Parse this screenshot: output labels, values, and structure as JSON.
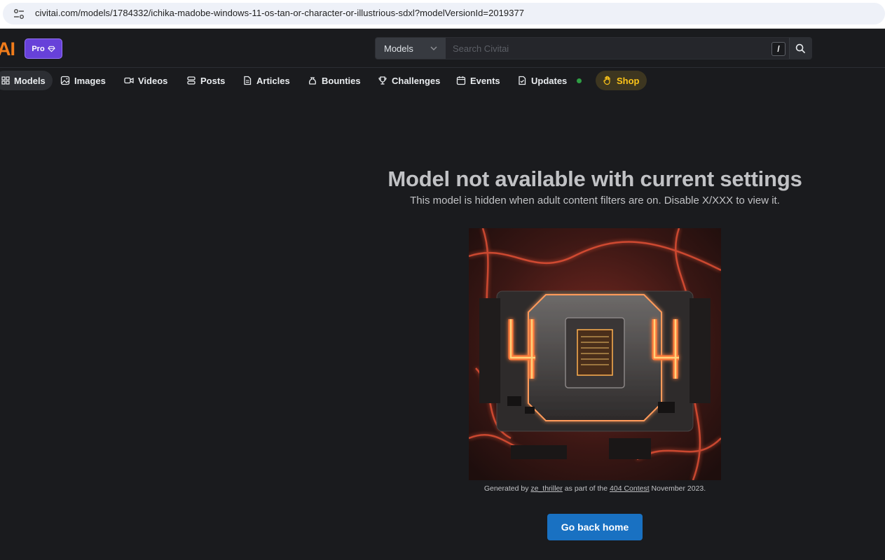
{
  "browser": {
    "url": "civitai.com/models/1784332/ichika-madobe-windows-11-os-tan-or-character-or-illustrious-sdxl?modelVersionId=2019377"
  },
  "header": {
    "logo_text": "AI",
    "pro_label": "Pro",
    "search": {
      "type_label": "Models",
      "placeholder": "Search Civitai",
      "shortcut": "/"
    }
  },
  "nav": {
    "tabs": [
      {
        "label": "Models",
        "icon": "models-icon",
        "active": true
      },
      {
        "label": "Images",
        "icon": "image-icon"
      },
      {
        "label": "Videos",
        "icon": "video-icon"
      },
      {
        "label": "Posts",
        "icon": "posts-icon"
      },
      {
        "label": "Articles",
        "icon": "article-icon"
      },
      {
        "label": "Bounties",
        "icon": "moneybag-icon"
      },
      {
        "label": "Challenges",
        "icon": "trophy-icon"
      },
      {
        "label": "Events",
        "icon": "calendar-icon"
      },
      {
        "label": "Updates",
        "icon": "updates-icon",
        "indicator": true
      },
      {
        "label": "Shop",
        "icon": "hand-icon",
        "highlight": true
      }
    ]
  },
  "main": {
    "title": "Model not available with current settings",
    "subtitle": "This model is hidden when adult content filters are on. Disable X/XXX to view it.",
    "art_text": "404",
    "caption": {
      "prefix": "Generated by ",
      "author": "ze_thriller",
      "middle": " as part of the ",
      "contest": "404 Contest",
      "suffix": " November 2023."
    },
    "home_button": "Go back home"
  },
  "colors": {
    "background": "#1a1b1e",
    "accent_blue": "#1971c2",
    "brand_orange": "#f07c1b",
    "pro_purple": "#6741d9",
    "shop_yellow": "#fcc419",
    "indicator_green": "#2f9e44"
  }
}
